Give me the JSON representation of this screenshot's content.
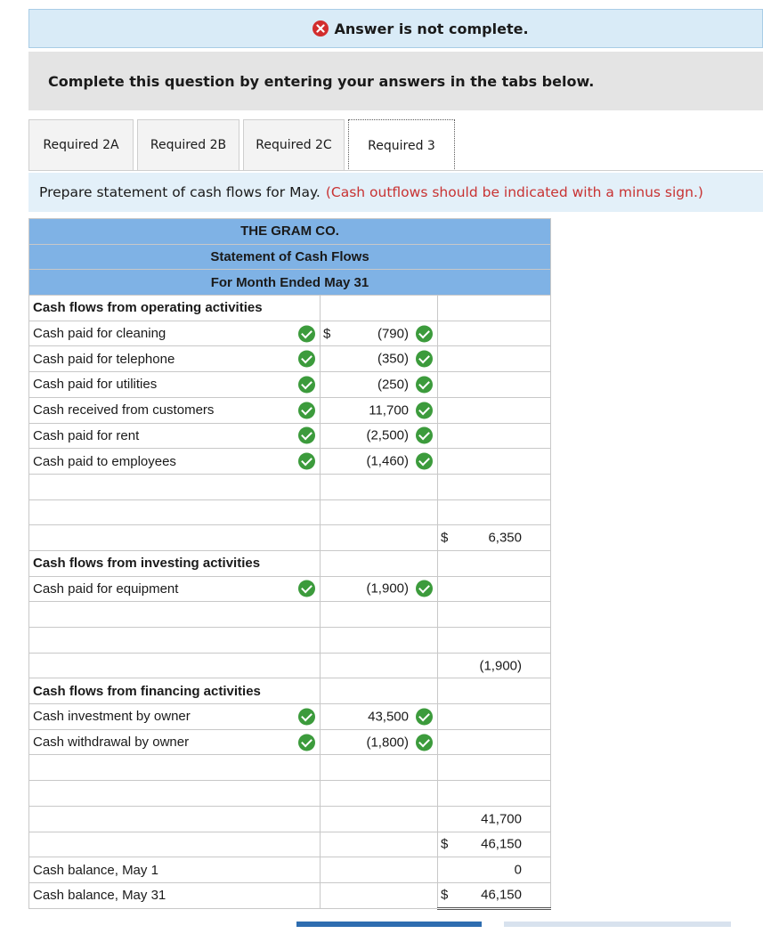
{
  "banner": {
    "text": "Answer is not complete.",
    "icon": "x-icon"
  },
  "instruction": "Complete this question by entering your answers in the tabs below.",
  "tabs": [
    "Required 2A",
    "Required 2B",
    "Required 2C",
    "Required 3"
  ],
  "active_tab": "Required 3",
  "prompt": {
    "main": "Prepare statement of cash flows for May.",
    "note": "(Cash outflows should be indicated with a minus sign.)"
  },
  "statement": {
    "company": "THE GRAM CO.",
    "title": "Statement of Cash Flows",
    "period": "For Month Ended May 31",
    "operating_header": "Cash flows from operating activities",
    "operating": [
      {
        "label": "Cash paid for cleaning",
        "currency": "$",
        "amount": "(790)"
      },
      {
        "label": "Cash paid for telephone",
        "currency": "",
        "amount": "(350)"
      },
      {
        "label": "Cash paid for utilities",
        "currency": "",
        "amount": "(250)"
      },
      {
        "label": "Cash received from customers",
        "currency": "",
        "amount": "11,700"
      },
      {
        "label": "Cash paid for rent",
        "currency": "",
        "amount": "(2,500)"
      },
      {
        "label": "Cash paid to employees",
        "currency": "",
        "amount": "(1,460)"
      }
    ],
    "operating_total": {
      "currency": "$",
      "amount": "6,350"
    },
    "investing_header": "Cash flows from investing activities",
    "investing": [
      {
        "label": "Cash paid for equipment",
        "amount": "(1,900)"
      }
    ],
    "investing_total": "(1,900)",
    "financing_header": "Cash flows from financing activities",
    "financing": [
      {
        "label": "Cash investment by owner",
        "amount": "43,500"
      },
      {
        "label": "Cash withdrawal by owner",
        "amount": "(1,800)"
      }
    ],
    "financing_total": "41,700",
    "net_change": {
      "currency": "$",
      "amount": "46,150"
    },
    "beginning_label": "Cash balance, May 1",
    "beginning_amount": "0",
    "ending_label": "Cash balance, May 31",
    "ending": {
      "currency": "$",
      "amount": "46,150"
    }
  },
  "colors": {
    "header_blue": "#7fb2e5",
    "check_green": "#3c9b3c",
    "error_red": "#d22d2d",
    "note_red": "#c83232"
  }
}
